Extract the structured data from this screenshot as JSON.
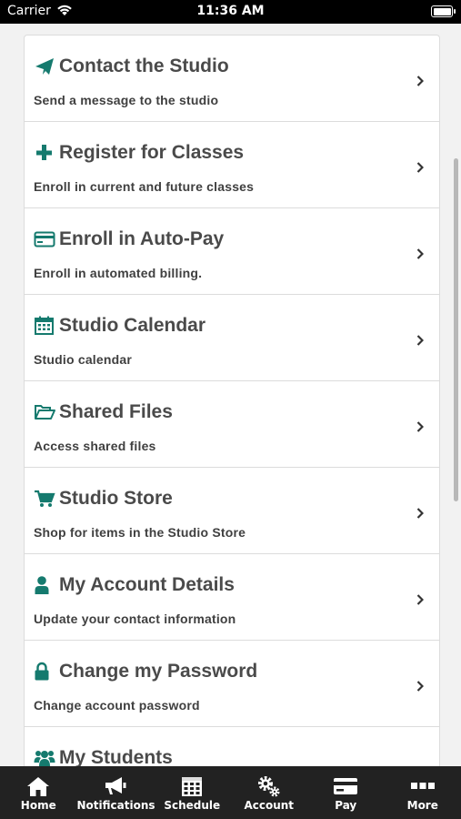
{
  "status_bar": {
    "carrier": "Carrier",
    "time": "11:36 AM"
  },
  "menu": {
    "items": [
      {
        "title": "Contact the Studio",
        "subtitle": "Send a message to the studio",
        "icon": "paper-plane-icon"
      },
      {
        "title": "Register for Classes",
        "subtitle": "Enroll in current and future classes",
        "icon": "plus-icon"
      },
      {
        "title": "Enroll in Auto-Pay",
        "subtitle": "Enroll in automated billing.",
        "icon": "credit-card-icon"
      },
      {
        "title": "Studio Calendar",
        "subtitle": "Studio calendar",
        "icon": "calendar-icon"
      },
      {
        "title": "Shared Files",
        "subtitle": "Access shared files",
        "icon": "folder-open-icon"
      },
      {
        "title": "Studio Store",
        "subtitle": "Shop for items in the Studio Store",
        "icon": "shopping-cart-icon"
      },
      {
        "title": "My Account Details",
        "subtitle": "Update your contact information",
        "icon": "user-icon"
      },
      {
        "title": "Change my Password",
        "subtitle": "Change account password",
        "icon": "lock-icon"
      },
      {
        "title": "My Students",
        "subtitle": "",
        "icon": "users-icon"
      }
    ]
  },
  "tabs": [
    {
      "label": "Home",
      "icon": "home-icon"
    },
    {
      "label": "Notifications",
      "icon": "megaphone-icon"
    },
    {
      "label": "Schedule",
      "icon": "calendar-grid-icon"
    },
    {
      "label": "Account",
      "icon": "gears-icon"
    },
    {
      "label": "Pay",
      "icon": "credit-card-icon"
    },
    {
      "label": "More",
      "icon": "ellipsis-icon"
    }
  ],
  "colors": {
    "accent": "#157a6e",
    "text": "#4a4a4a",
    "tab_bar": "#222222"
  }
}
